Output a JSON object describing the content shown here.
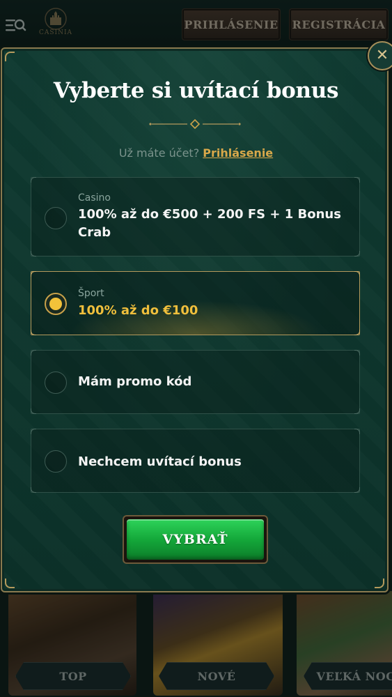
{
  "header": {
    "logo_text": "CASINIA",
    "login_label": "PRIHLÁSENIE",
    "register_label": "REGISTRÁCIA"
  },
  "games": {
    "labels": [
      "TOP",
      "NOVÉ",
      "VEĽKÁ NOC"
    ]
  },
  "modal": {
    "title": "Vyberte si uvítací bonus",
    "account_question": "Už máte účet?",
    "account_link": "Prihlásenie",
    "options": [
      {
        "category": "Casino",
        "text": "100% až do €500 + 200 FS + 1 Bonus Crab",
        "selected": false
      },
      {
        "category": "Šport",
        "text": "100% až do €100",
        "selected": true
      },
      {
        "category": "",
        "text": "Mám promo kód",
        "selected": false
      },
      {
        "category": "",
        "text": "Nechcem uvítací bonus",
        "selected": false
      }
    ],
    "submit_label": "VYBRAŤ"
  },
  "colors": {
    "accent_gold": "#f2c23a",
    "link_gold": "#d8a84a",
    "modal_bg": "#0f3a31",
    "cta_green": "#14a83a"
  },
  "icons": [
    "menu-search-icon",
    "castle-logo-icon",
    "close-icon",
    "ornament-divider-icon"
  ]
}
